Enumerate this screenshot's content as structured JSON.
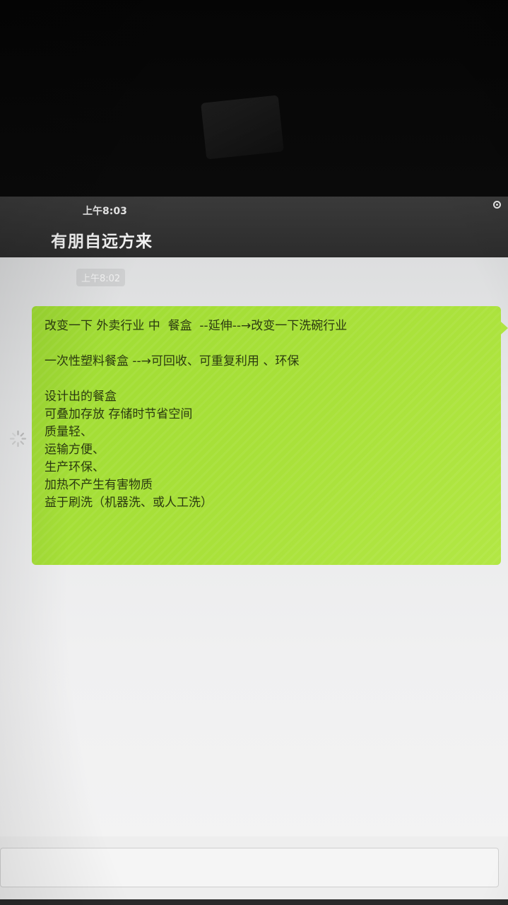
{
  "status_bar": {
    "time": "上午8:03",
    "icon": "alarm-icon"
  },
  "header": {
    "title": "有朋自远方来"
  },
  "conversation": {
    "timestamp": "上午8:02",
    "loading_icon": "spinner-icon",
    "message": {
      "lines": [
        "改变一下 外卖行业 中  餐盒  --延伸--→改变一下洗碗行业",
        "",
        "一次性塑料餐盒 --→可回收、可重复利用 、环保",
        "",
        "设计出的餐盒",
        "可叠加存放 存储时节省空间",
        "质量轻、",
        "运输方便、",
        "生产环保、",
        "加热不产生有害物质",
        "益于刷洗（机器洗、或人工洗）"
      ]
    }
  },
  "input": {
    "placeholder": ""
  },
  "colors": {
    "bubble": "#a9e13a",
    "header": "#2f2f2f"
  }
}
